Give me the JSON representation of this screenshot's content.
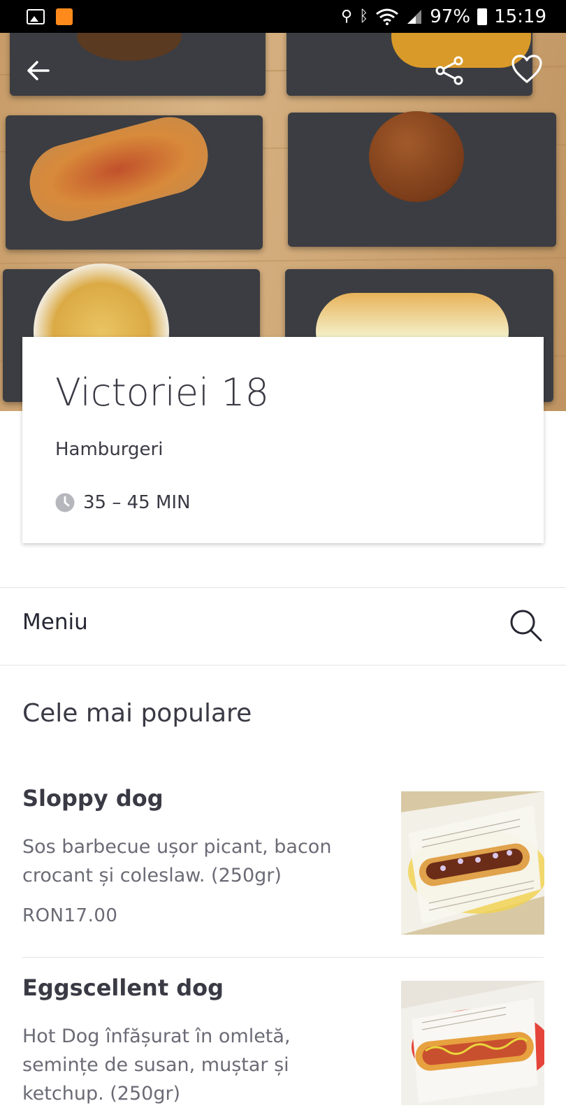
{
  "status_bar": {
    "battery": "97%",
    "time": "15:19"
  },
  "hero": {
    "back_icon": "arrow-left-icon",
    "share_icon": "share-icon",
    "favorite_icon": "heart-outline-icon"
  },
  "restaurant": {
    "name": "Victoriei 18",
    "cuisine": "Hamburgeri",
    "delivery_time": "35 – 45 MIN"
  },
  "menu": {
    "label": "Meniu",
    "search_icon": "search-icon"
  },
  "section": {
    "title": "Cele mai populare"
  },
  "items": [
    {
      "name": "Sloppy dog",
      "description": "Sos barbecue ușor picant, bacon crocant și coleslaw. (250gr)",
      "price": "RON17.00"
    },
    {
      "name": "Eggscellent dog",
      "description": "Hot Dog înfășurat în omletă, semințe de susan, muștar și ketchup. (250gr)",
      "price": ""
    }
  ]
}
